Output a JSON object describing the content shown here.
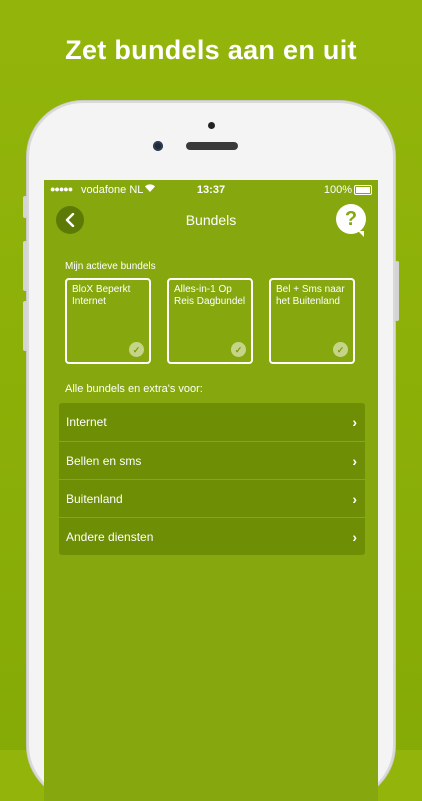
{
  "headline": "Zet bundels aan en uit",
  "status_bar": {
    "signal": "●●●●●",
    "carrier": "vodafone NL",
    "wifi_icon": "wifi-icon",
    "time": "13:37",
    "battery": "100%"
  },
  "navbar": {
    "back_icon": "chevron-left-icon",
    "title": "Bundels",
    "help_label": "?"
  },
  "active_bundles": {
    "label": "Mijn actieve bundels",
    "cards": [
      {
        "name": "BloX Beperkt Internet",
        "check": "✓"
      },
      {
        "name": "Alles-in-1 Op Reis Dagbundel",
        "check": "✓"
      },
      {
        "name": "Bel + Sms naar het Buitenland",
        "check": "✓"
      }
    ]
  },
  "all_bundles": {
    "label": "Alle bundels en extra's voor:",
    "items": [
      {
        "label": "Internet",
        "chevron": "›"
      },
      {
        "label": "Bellen en sms",
        "chevron": "›"
      },
      {
        "label": "Buitenland",
        "chevron": "›"
      },
      {
        "label": "Andere diensten",
        "chevron": "›"
      }
    ]
  },
  "colors": {
    "background": "#93b50b",
    "screen": "#86a80e",
    "list_row": "#6e8e05",
    "back_button": "#5e7a06"
  }
}
